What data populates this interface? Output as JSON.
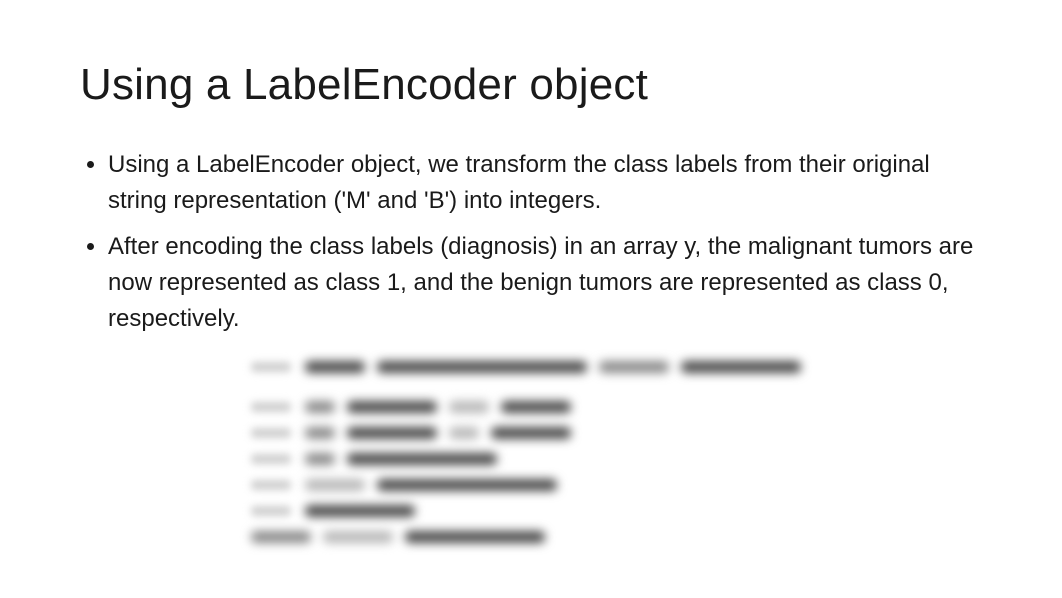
{
  "title": "Using a LabelEncoder object",
  "bullets": [
    "Using a LabelEncoder object, we transform the class labels from their original string representation ('M' and 'B') into integers.",
    "After encoding the class labels (diagnosis) in an array y, the malignant tumors are now represented as class 1, and the benign tumors are represented as class 0, respectively."
  ]
}
